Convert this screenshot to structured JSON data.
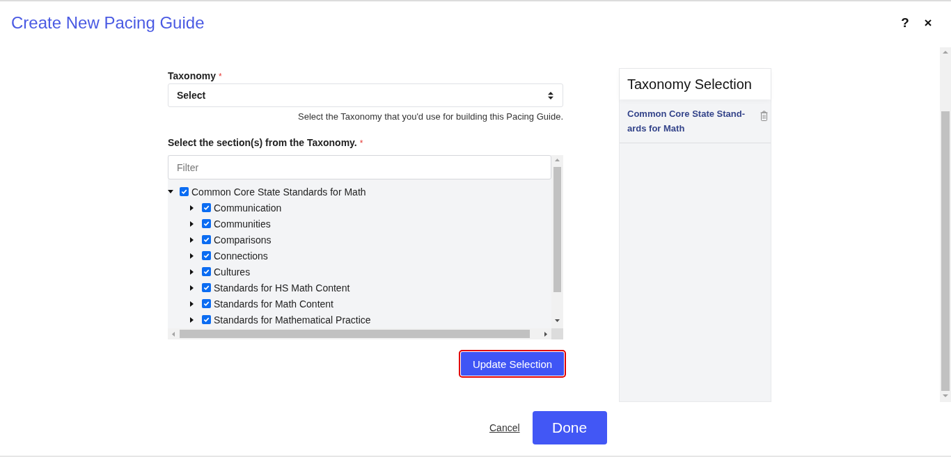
{
  "header": {
    "title": "Create New Pacing Guide",
    "help_label": "?",
    "close_label": "×"
  },
  "taxonomy_field": {
    "label": "Taxonomy",
    "required_mark": "*",
    "value": "Select",
    "help_text": "Select the Taxonomy that you'd use for building this Pacing Guide."
  },
  "sections": {
    "label": "Select the section(s) from the Taxonomy.",
    "required_mark": "*",
    "filter": {
      "placeholder": "Filter"
    },
    "tree": [
      {
        "label": "Common Core State Standards for Math",
        "checked": true,
        "expanded": true,
        "children": [
          {
            "label": "Communication",
            "checked": true,
            "expanded": false
          },
          {
            "label": "Communities",
            "checked": true,
            "expanded": false
          },
          {
            "label": "Comparisons",
            "checked": true,
            "expanded": false
          },
          {
            "label": "Connections",
            "checked": true,
            "expanded": false
          },
          {
            "label": "Cultures",
            "checked": true,
            "expanded": false
          },
          {
            "label": "Standards for HS Math Content",
            "checked": true,
            "expanded": false
          },
          {
            "label": "Standards for Math Content",
            "checked": true,
            "expanded": false
          },
          {
            "label": "Standards for Mathematical Practice",
            "checked": true,
            "expanded": false
          }
        ]
      }
    ]
  },
  "update_button": {
    "label": "Update Selection",
    "highlighted": true
  },
  "selection_panel": {
    "title": "Taxonomy Selection",
    "items": [
      {
        "label": "Common Core State Stand-ards for Math"
      }
    ]
  },
  "footer": {
    "cancel": "Cancel",
    "done": "Done"
  }
}
